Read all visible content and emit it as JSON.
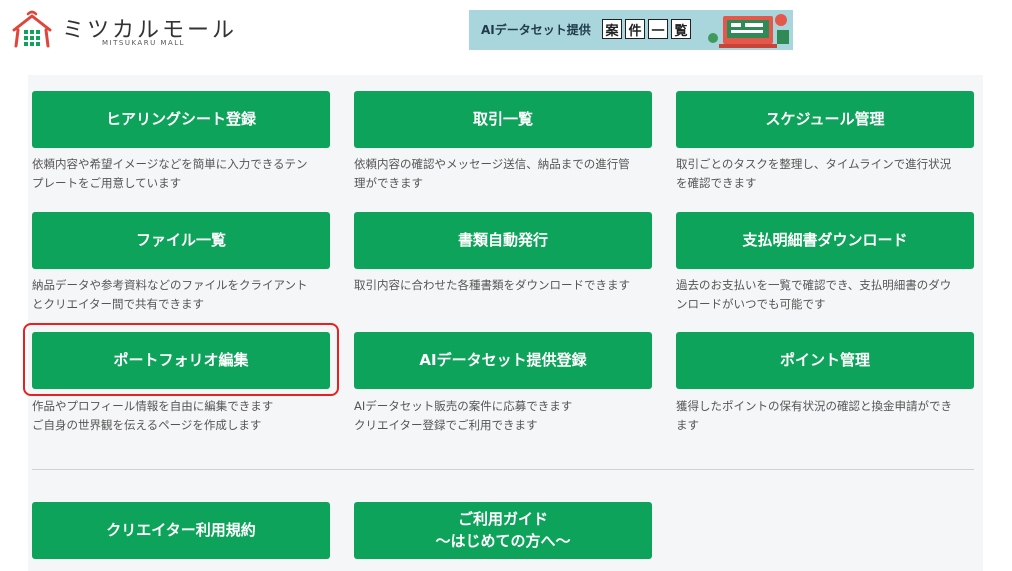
{
  "header": {
    "logo_text": "ミツカルモール",
    "logo_sub": "MITSUKARU MALL",
    "logo_icon": "house-shop-icon",
    "banner": {
      "text": "AIデータセット提供",
      "boxes": [
        "案",
        "件",
        "一",
        "覧"
      ],
      "art_icon": "computer-illustration-icon"
    }
  },
  "menu": [
    {
      "label": "ヒアリングシート登録",
      "desc": [
        "依頼内容や希望イメージなどを簡単に入力できるテン",
        "プレートをご用意しています"
      ]
    },
    {
      "label": "取引一覧",
      "desc": [
        "依頼内容の確認やメッセージ送信、納品までの進行管",
        "理ができます"
      ]
    },
    {
      "label": "スケジュール管理",
      "desc": [
        "取引ごとのタスクを整理し、タイムラインで進行状況",
        "を確認できます"
      ]
    },
    {
      "label": "ファイル一覧",
      "desc": [
        "納品データや参考資料などのファイルをクライアント",
        "とクリエイター間で共有できます"
      ]
    },
    {
      "label": "書類自動発行",
      "desc": [
        "取引内容に合わせた各種書類をダウンロードできます",
        ""
      ]
    },
    {
      "label": "支払明細書ダウンロード",
      "desc": [
        "過去のお支払いを一覧で確認でき、支払明細書のダウ",
        "ンロードがいつでも可能です"
      ]
    },
    {
      "label": "ポートフォリオ編集",
      "desc": [
        "作品やプロフィール情報を自由に編集できます",
        "ご自身の世界観を伝えるページを作成します"
      ]
    },
    {
      "label": "AIデータセット提供登録",
      "desc": [
        "AIデータセット販売の案件に応募できます",
        "クリエイター登録でご利用できます"
      ]
    },
    {
      "label": "ポイント管理",
      "desc": [
        "獲得したポイントの保有状況の確認と換金申請ができ",
        "ます"
      ]
    }
  ],
  "bottom": [
    {
      "line1": "クリエイター利用規約",
      "line2": ""
    },
    {
      "line1": "ご利用ガイド",
      "line2": "〜はじめての方へ〜"
    }
  ],
  "colors": {
    "button_green": "#0ea35a",
    "highlight_red": "#e8201f",
    "panel_bg": "#f5f6f7"
  }
}
